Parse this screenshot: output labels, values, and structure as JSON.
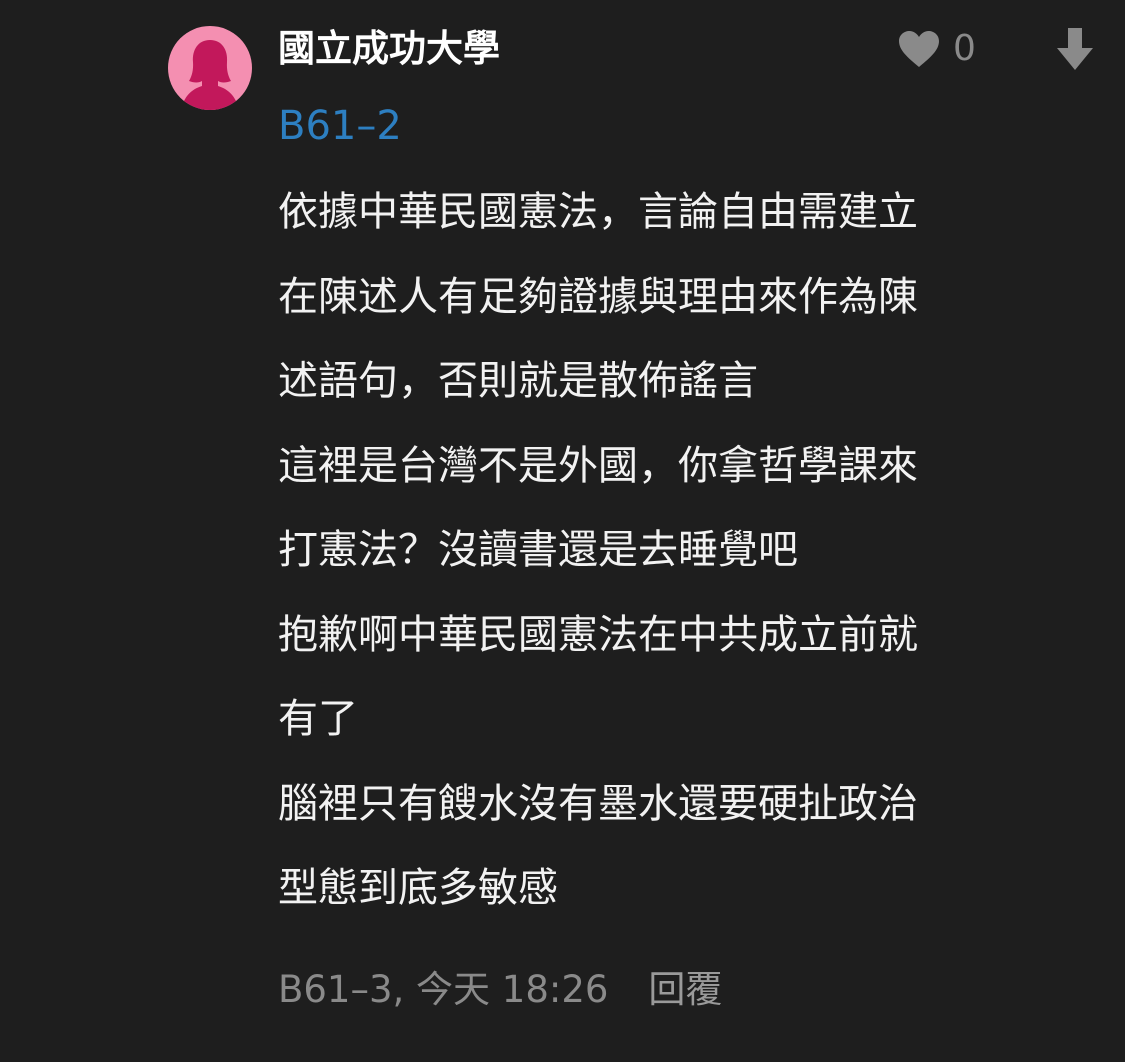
{
  "comment": {
    "author": "國立成功大學",
    "avatar_icon": "female-silhouette-icon",
    "avatar_color": "#f48fb1",
    "like_icon": "heart-icon",
    "like_count": "0",
    "downvote_icon": "arrow-down-icon",
    "floor_reference": "B61–2",
    "floor_reference_color": "#2d7fc1",
    "content_lines": [
      "依據中華民國憲法，言論自由需建立",
      "在陳述人有足夠證據與理由來作為陳",
      "述語句，否則就是散佈謠言",
      "這裡是台灣不是外國，你拿哲學課來",
      "打憲法？沒讀書還是去睡覺吧",
      "抱歉啊中華民國憲法在中共成立前就",
      "有了",
      "腦裡只有餿水沒有墨水還要硬扯政治",
      "型態到底多敏感"
    ],
    "meta": "B61–3, 今天 18:26",
    "reply_label": "回覆"
  }
}
